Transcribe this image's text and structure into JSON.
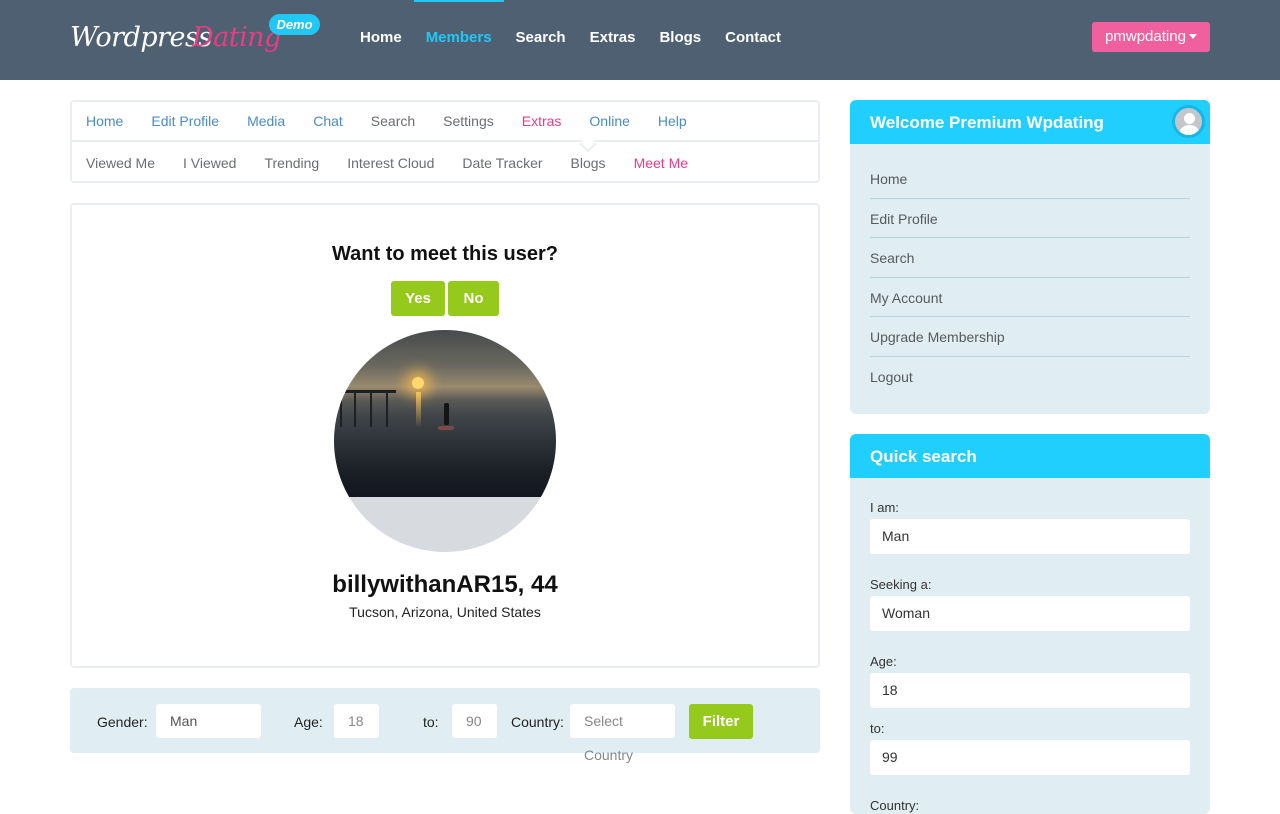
{
  "header": {
    "logo_word1": "Wordpress",
    "logo_word2": "Dating",
    "demo_badge": "Demo",
    "nav": [
      {
        "label": "Home",
        "active": false
      },
      {
        "label": "Members",
        "active": true
      },
      {
        "label": "Search",
        "active": false
      },
      {
        "label": "Extras",
        "active": false
      },
      {
        "label": "Blogs",
        "active": false
      },
      {
        "label": "Contact",
        "active": false
      }
    ],
    "user_menu_label": "pmwpdating"
  },
  "subnav": {
    "row1": [
      "Home",
      "Edit Profile",
      "Media",
      "Chat",
      "Search",
      "Settings",
      "Extras",
      "Online",
      "Help"
    ],
    "row2": [
      "Viewed Me",
      "I Viewed",
      "Trending",
      "Interest Cloud",
      "Date Tracker",
      "Blogs",
      "Meet Me"
    ],
    "active_top": "Extras",
    "active_sub": "Meet Me"
  },
  "meet": {
    "question": "Want to meet this user?",
    "yes_label": "Yes",
    "no_label": "No",
    "profile_name": "billywithanAR15, 44",
    "profile_location": "Tucson, Arizona, United States"
  },
  "filter": {
    "gender_label": "Gender:",
    "gender_value": "Man",
    "age_label": "Age:",
    "age_from": "18",
    "to_label": "to:",
    "age_to": "90",
    "country_label": "Country:",
    "country_placeholder": "Select Country",
    "filter_button": "Filter"
  },
  "welcome_widget": {
    "title": "Welcome Premium Wpdating",
    "links": [
      "Home",
      "Edit Profile",
      "Search",
      "My Account",
      "Upgrade Membership",
      "Logout"
    ]
  },
  "quick_search": {
    "title": "Quick search",
    "i_am_label": "I am:",
    "i_am_value": "Man",
    "seeking_label": "Seeking a:",
    "seeking_value": "Woman",
    "age_label": "Age:",
    "age_from": "18",
    "to_label": "to:",
    "age_to": "99",
    "country_label": "Country:"
  },
  "colors": {
    "header_bg": "#4f6073",
    "accent_cyan": "#21cfff",
    "accent_pink": "#ec3b83",
    "user_button": "#f0609e",
    "button_green": "#95c91b",
    "widget_bg": "#e0eef3"
  }
}
